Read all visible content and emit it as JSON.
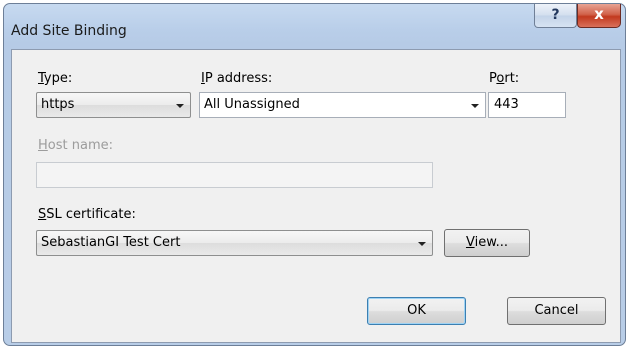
{
  "dialog": {
    "title": "Add Site Binding",
    "help_label": "?",
    "close_label": "x"
  },
  "type": {
    "label_accel": "T",
    "label_rest": "ype:",
    "value": "https"
  },
  "ip_address": {
    "label_accel": "I",
    "label_rest": "P address:",
    "value": "All Unassigned"
  },
  "port": {
    "label_pre": "P",
    "label_accel": "o",
    "label_rest": "rt:",
    "value": "443"
  },
  "host_name": {
    "label_accel": "H",
    "label_rest": "ost name:",
    "value": "",
    "enabled": false
  },
  "ssl_certificate": {
    "label_accel": "S",
    "label_rest": "SL certificate:",
    "value": "SebastianGI Test Cert"
  },
  "buttons": {
    "view_accel": "V",
    "view_rest": "iew...",
    "ok": "OK",
    "cancel": "Cancel"
  }
}
